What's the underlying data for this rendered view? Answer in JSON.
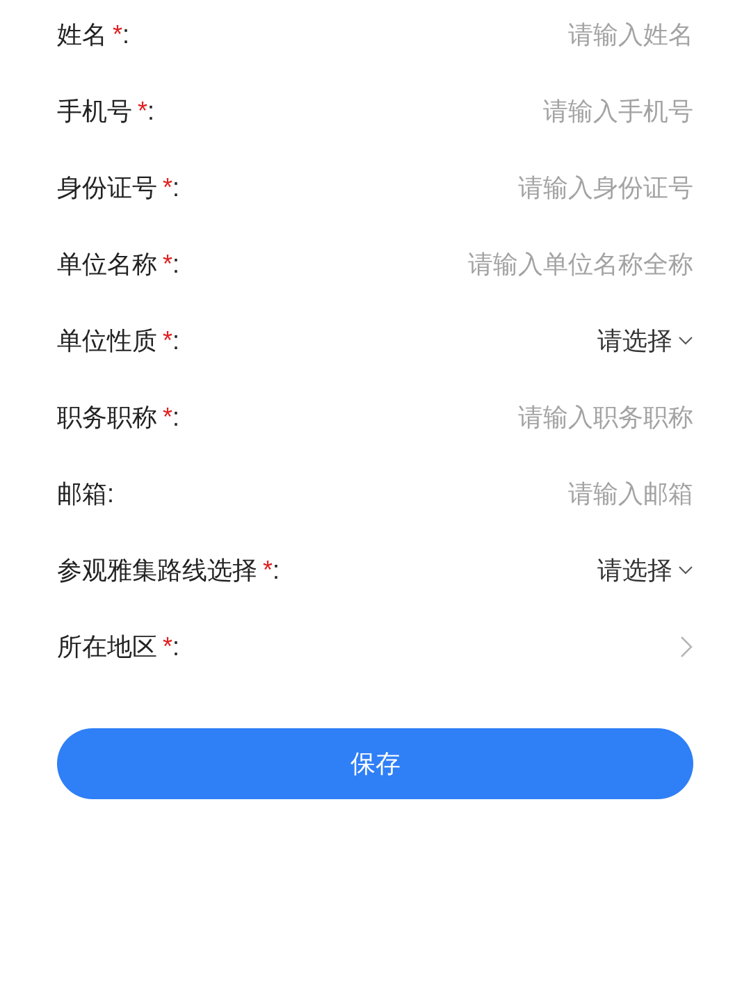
{
  "fields": [
    {
      "kind": "input",
      "label": "姓名",
      "required_mark": "*",
      "colon": ":",
      "placeholder": "请输入姓名"
    },
    {
      "kind": "input",
      "label": "手机号",
      "required_mark": "*",
      "colon": ":",
      "placeholder": "请输入手机号"
    },
    {
      "kind": "input",
      "label": "身份证号",
      "required_mark": "*",
      "colon": ":",
      "placeholder": "请输入身份证号"
    },
    {
      "kind": "input",
      "label": "单位名称",
      "required_mark": "*",
      "colon": ":",
      "placeholder": "请输入单位名称全称"
    },
    {
      "kind": "select",
      "label": "单位性质",
      "required_mark": "*",
      "colon": ":",
      "value": "请选择"
    },
    {
      "kind": "input",
      "label": "职务职称",
      "required_mark": "*",
      "colon": ":",
      "placeholder": "请输入职务职称"
    },
    {
      "kind": "input",
      "label": "邮箱",
      "colon": ":",
      "placeholder": "请输入邮箱"
    },
    {
      "kind": "select",
      "label": "参观雅集路线选择",
      "required_mark": "*",
      "colon": ":",
      "value": "请选择"
    },
    {
      "kind": "region",
      "label": "所在地区",
      "required_mark": "*",
      "colon": ":"
    }
  ],
  "save_button": "保存"
}
